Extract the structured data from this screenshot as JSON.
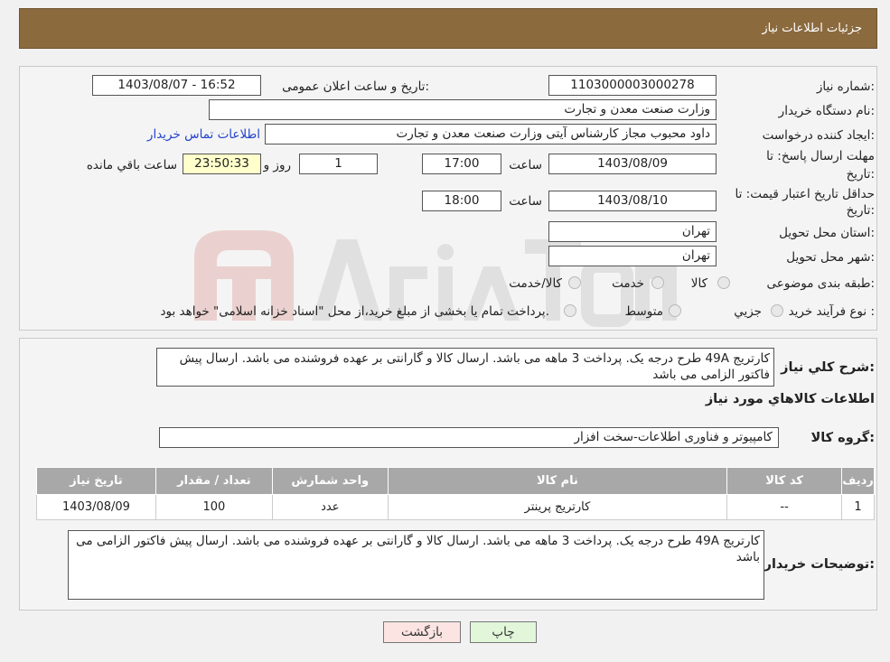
{
  "header": {
    "title": "جزئیات اطلاعات نیاز"
  },
  "details": {
    "need_number_label": "شماره نیاز:",
    "need_number": "1103000003000278",
    "announce_label": "تاریخ و ساعت اعلان عمومی:",
    "announce_value": "1403/08/07 - 16:52",
    "buyer_org_label": "نام دستگاه خریدار:",
    "buyer_org": "وزارت صنعت معدن و تجارت",
    "requester_label": "ایجاد کننده درخواست:",
    "requester": "داود محبوب مجاز کارشناس آیتی وزارت صنعت معدن و تجارت",
    "contact_link": "اطلاعات تماس خریدار",
    "deadline_label_1": "مهلت ارسال پاسخ: تا",
    "deadline_label_2": "تاریخ:",
    "deadline_date": "1403/08/09",
    "time_label": "ساعت",
    "deadline_time": "17:00",
    "days_value": "1",
    "days_label": "روز و",
    "remaining_time": "23:50:33",
    "remaining_label": "ساعت باقي مانده",
    "validity_label_1": "حداقل تاریخ اعتبار قیمت: تا",
    "validity_label_2": "تاریخ:",
    "validity_date": "1403/08/10",
    "validity_time": "18:00",
    "province_label": "استان محل تحویل:",
    "province": "تهران",
    "city_label": "شهر محل تحویل:",
    "city": "تهران",
    "category_label": "طبقه بندی موضوعی:",
    "category_options": [
      "کالا",
      "خدمت",
      "کالا/خدمت"
    ],
    "process_label": "نوع فرآیند خرید :",
    "process_options": [
      "جزیي",
      "متوسط"
    ],
    "process_note": "پرداخت تمام یا بخشی از مبلغ خرید،از محل \"اسناد خزانه اسلامی\" خواهد بود."
  },
  "summary": {
    "label": "شرح کلي نياز:",
    "text": "کارتریج 49A طرح درجه یک. پرداخت 3 ماهه می باشد. ارسال کالا و گارانتی بر عهده فروشنده می باشد. ارسال پیش فاکتور الزامی می باشد"
  },
  "goods": {
    "section_title": "اطلاعات کالاهاي مورد نياز",
    "group_label": "گروه کالا:",
    "group_value": "کامپیوتر و فناوری اطلاعات-سخت افزار",
    "columns": [
      "رديف",
      "کد کالا",
      "نام کالا",
      "واحد شمارش",
      "تعداد / مقدار",
      "تاریخ نیاز"
    ],
    "rows": [
      [
        "1",
        "--",
        "کارتریج پرینتر",
        "عدد",
        "100",
        "1403/08/09"
      ]
    ]
  },
  "buyer_notes": {
    "label": "توضیحات خریدار:",
    "text": "کارتریج 49A طرح درجه یک. پرداخت 3 ماهه می باشد. ارسال کالا و گارانتی بر عهده فروشنده می باشد. ارسال پیش فاکتور الزامی می باشد"
  },
  "buttons": {
    "back": "بازگشت",
    "print": "چاپ"
  },
  "colors": {
    "header_bg": "#8b6a3e",
    "table_header_bg": "#a8a8a8",
    "remaining_bg": "#ffffcc"
  }
}
